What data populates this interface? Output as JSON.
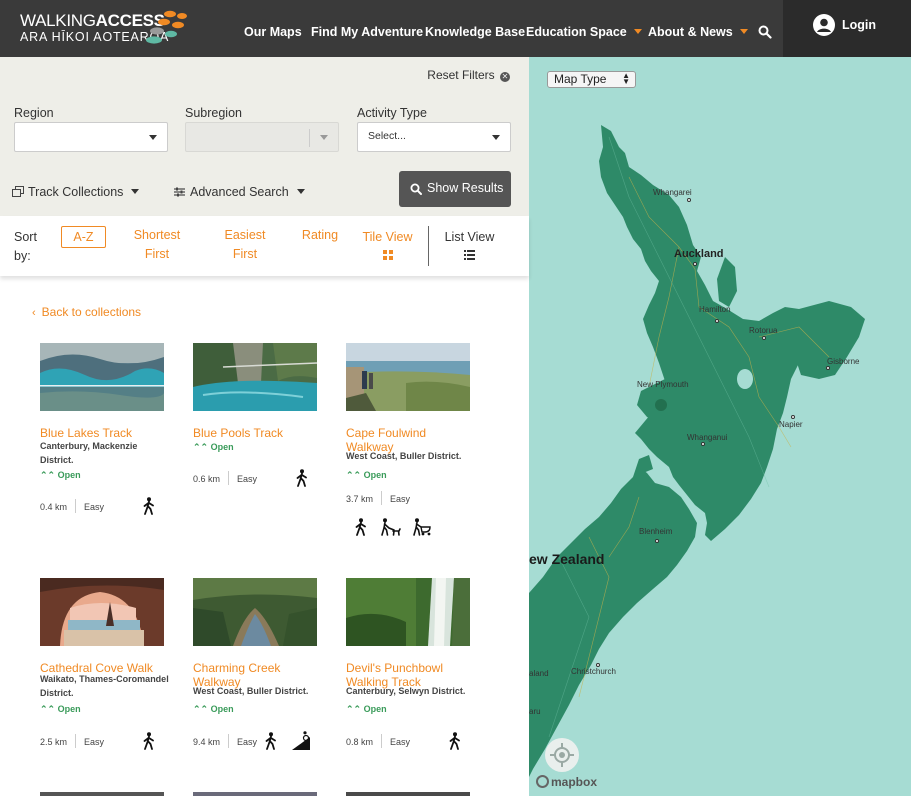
{
  "header": {
    "logo_line1_a": "WALKING",
    "logo_line1_b": "ACCESS",
    "logo_line2": "ARA HĪKOI AOTEAROA",
    "nav": [
      {
        "label": "Our Maps"
      },
      {
        "label": "Find My Adventure"
      },
      {
        "label": "Knowledge Base"
      },
      {
        "label": "Education Space"
      },
      {
        "label": "About & News"
      }
    ],
    "login_label": "Login",
    "accent_color": "#f08a24"
  },
  "filters": {
    "reset_label": "Reset Filters",
    "region_label": "Region",
    "subregion_label": "Subregion",
    "activity_label": "Activity Type",
    "activity_placeholder": "Select...",
    "track_collections_label": "Track Collections",
    "advanced_search_label": "Advanced Search",
    "show_results_label": "Show Results"
  },
  "sort": {
    "sort_by_label": "Sort by:",
    "options": [
      {
        "label": "A-Z"
      },
      {
        "label": "Shortest First"
      },
      {
        "label": "Easiest First"
      },
      {
        "label": "Rating"
      }
    ],
    "tile_view_label": "Tile View",
    "list_view_label": "List View"
  },
  "results": {
    "back_label": "Back to collections",
    "cards": [
      {
        "title": "Blue Lakes Track",
        "location": "Canterbury, Mackenzie District.",
        "status": "Open",
        "distance": "0.4 km",
        "difficulty": "Easy",
        "activities": [
          "walking-icon"
        ]
      },
      {
        "title": "Blue Pools Track",
        "location": "",
        "status": "Open",
        "distance": "0.6 km",
        "difficulty": "Easy",
        "activities": [
          "walking-icon"
        ]
      },
      {
        "title": "Cape Foulwind Walkway",
        "location": "West Coast, Buller District.",
        "status": "Open",
        "distance": "3.7 km",
        "difficulty": "Easy",
        "activities": [
          "walking-icon",
          "dog-walking-icon",
          "stroller-icon"
        ]
      },
      {
        "title": "Cathedral Cove Walk",
        "location": "Waikato, Thames-Coromandel District.",
        "status": "Open",
        "distance": "2.5 km",
        "difficulty": "Easy",
        "activities": [
          "walking-icon"
        ]
      },
      {
        "title": "Charming Creek Walkway",
        "location": "West Coast, Buller District.",
        "status": "Open",
        "distance": "9.4 km",
        "difficulty": "Easy",
        "activities": [
          "walking-icon",
          "mountain-biking-icon"
        ]
      },
      {
        "title": "Devil's Punchbowl Walking Track",
        "location": "Canterbury, Selwyn District.",
        "status": "Open",
        "distance": "0.8 km",
        "difficulty": "Easy",
        "activities": [
          "walking-icon"
        ]
      }
    ]
  },
  "map": {
    "map_type_label": "Map Type",
    "places": [
      {
        "name": "Whangarei"
      },
      {
        "name": "Auckland"
      },
      {
        "name": "Hamilton"
      },
      {
        "name": "Rotorua"
      },
      {
        "name": "Gisborne"
      },
      {
        "name": "New Plymouth"
      },
      {
        "name": "Napier"
      },
      {
        "name": "Whanganui"
      },
      {
        "name": "Blenheim"
      },
      {
        "name": "ew Zealand"
      },
      {
        "name": "Christchurch"
      },
      {
        "name": "aland"
      },
      {
        "name": "aru"
      }
    ],
    "attribution": "mapbox",
    "water_color": "#a6dcd3",
    "land_color": "#2e8a68"
  }
}
